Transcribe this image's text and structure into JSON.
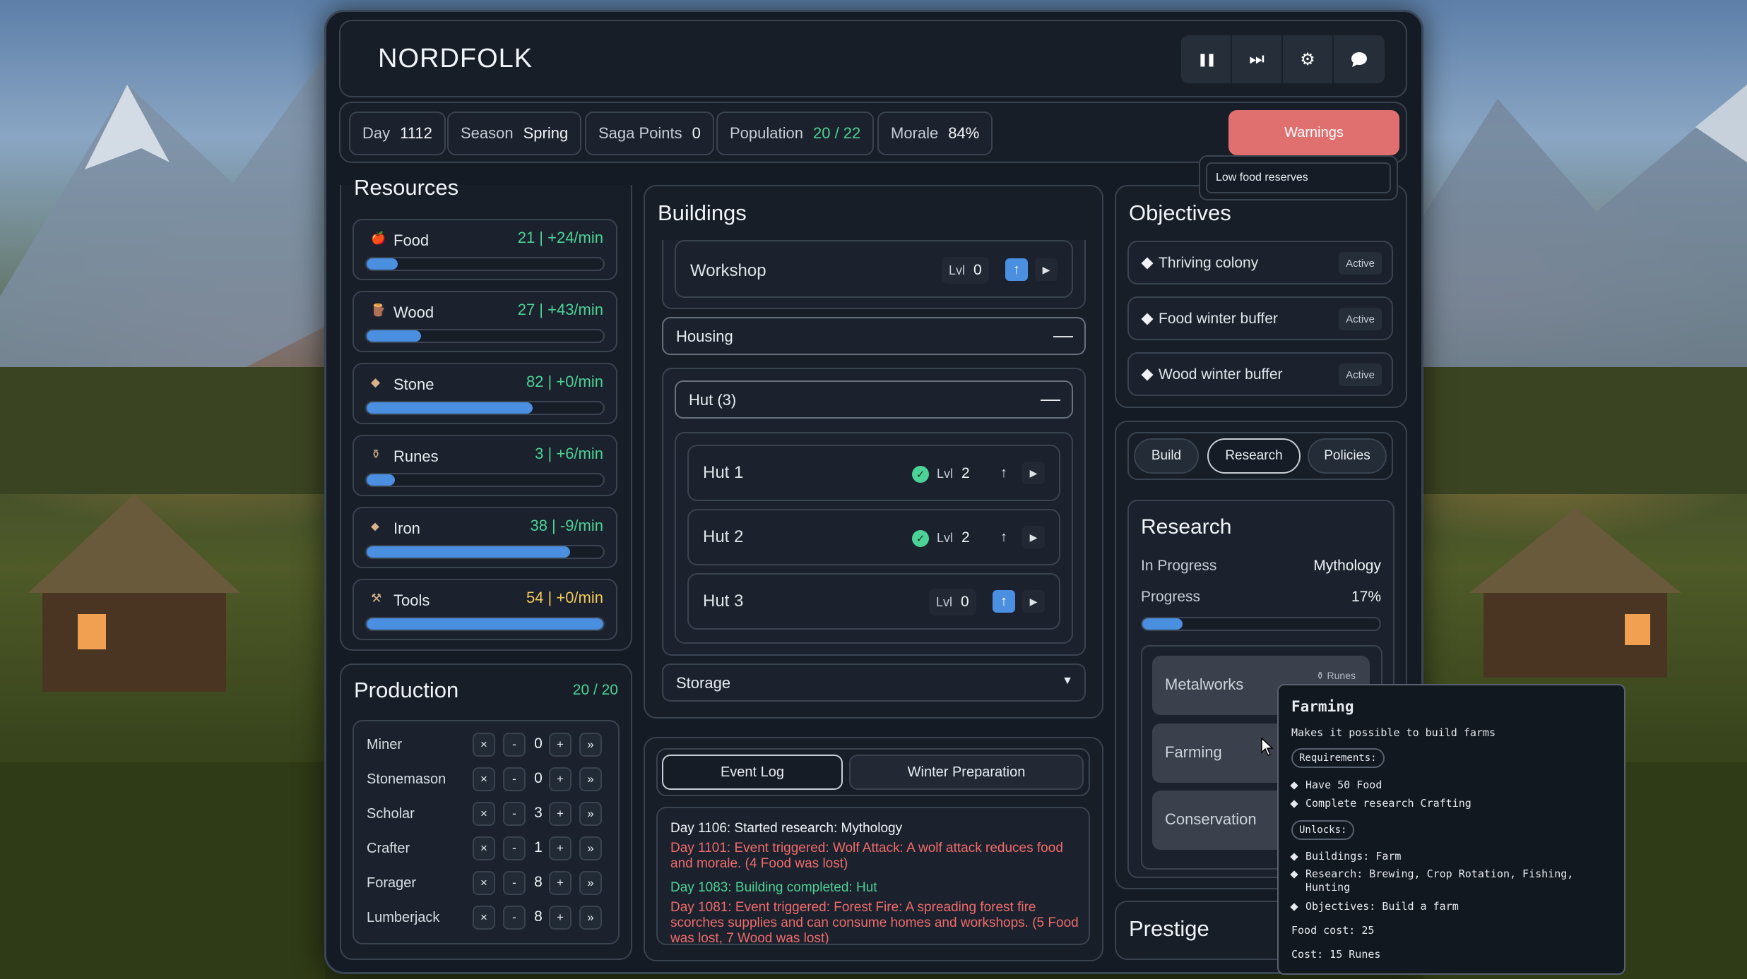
{
  "app_title": "NORDFOLK",
  "controls": [
    {
      "name": "pause-icon",
      "glyph": "❚❚"
    },
    {
      "name": "skip-forward-icon",
      "glyph": "⏭"
    },
    {
      "name": "gear-icon",
      "glyph": "⚙"
    },
    {
      "name": "chat-bubble-icon",
      "glyph": "💬"
    }
  ],
  "stats": {
    "day": {
      "label": "Day",
      "value": "1112"
    },
    "season": {
      "label": "Season",
      "value": "Spring"
    },
    "saga": {
      "label": "Saga Points",
      "value": "0"
    },
    "population": {
      "label": "Population",
      "value": "20 / 22"
    },
    "morale": {
      "label": "Morale",
      "value": "84%"
    }
  },
  "warnings": {
    "label": "Warnings",
    "items": [
      "Low food reserves"
    ]
  },
  "resources": {
    "title": "Resources",
    "items": [
      {
        "name": "Food",
        "icon": "apple-icon",
        "value": "21 | +24/min",
        "fill": 0.13,
        "value_color": "green"
      },
      {
        "name": "Wood",
        "icon": "log-icon",
        "value": "27 | +43/min",
        "fill": 0.23,
        "value_color": "green"
      },
      {
        "name": "Stone",
        "icon": "stone-icon",
        "value": "82 | +0/min",
        "fill": 0.7,
        "value_color": "green"
      },
      {
        "name": "Runes",
        "icon": "rune-icon",
        "value": "3 | +6/min",
        "fill": 0.12,
        "value_color": "green"
      },
      {
        "name": "Iron",
        "icon": "iron-icon",
        "value": "38 | -9/min",
        "fill": 0.86,
        "value_color": "green"
      },
      {
        "name": "Tools",
        "icon": "tools-icon",
        "value": "54 | +0/min",
        "fill": 1.0,
        "value_color": "yellow"
      }
    ]
  },
  "production": {
    "title": "Production",
    "count": "20 / 20",
    "rows": [
      {
        "name": "Miner",
        "value": "0"
      },
      {
        "name": "Stonemason",
        "value": "0"
      },
      {
        "name": "Scholar",
        "value": "3"
      },
      {
        "name": "Crafter",
        "value": "1"
      },
      {
        "name": "Forager",
        "value": "8"
      },
      {
        "name": "Lumberjack",
        "value": "8"
      }
    ],
    "btn_clear": "×",
    "btn_minus": "-",
    "btn_plus": "+",
    "btn_max": "»"
  },
  "buildings": {
    "title": "Buildings",
    "workshop": {
      "name": "Workshop",
      "lvl_label": "Lvl",
      "lvl": "0"
    },
    "housing_label": "Housing",
    "hut_group_label": "Hut (3)",
    "huts": [
      {
        "name": "Hut 1",
        "lvl": "2",
        "built": true
      },
      {
        "name": "Hut 2",
        "lvl": "2",
        "built": true
      },
      {
        "name": "Hut 3",
        "lvl": "0",
        "built": false
      }
    ],
    "lvl_label": "Lvl",
    "storage_label": "Storage"
  },
  "log": {
    "tabs": [
      "Event Log",
      "Winter Preparation"
    ],
    "entries": [
      {
        "text": "Day 1106: Started research: Mythology",
        "color": "#f1f4f8"
      },
      {
        "text": "Day 1101: Event triggered: Wolf Attack: A wolf attack reduces food and morale. (4 Food was lost)",
        "color": "#ef6b6b"
      },
      {
        "text": "Day 1083: Building completed: Hut",
        "color": "#4cd296"
      },
      {
        "text": "Day 1081: Event triggered: Forest Fire: A spreading forest fire scorches supplies and can consume homes and workshops. (5 Food was lost, 7 Wood was lost)",
        "color": "#ef6b6b"
      }
    ]
  },
  "objectives": {
    "title": "Objectives",
    "items": [
      {
        "name": "Thriving colony",
        "status": "Active"
      },
      {
        "name": "Food winter buffer",
        "status": "Active"
      },
      {
        "name": "Wood winter buffer",
        "status": "Active"
      }
    ]
  },
  "right_tabs": [
    "Build",
    "Research",
    "Policies"
  ],
  "research": {
    "title": "Research",
    "in_progress_label": "In Progress",
    "in_progress_value": "Mythology",
    "progress_label": "Progress",
    "progress_value": "17%",
    "progress_fraction": 0.17,
    "items": [
      {
        "name": "Metalworks",
        "cost": "Runes"
      },
      {
        "name": "Farming"
      },
      {
        "name": "Conservation"
      }
    ]
  },
  "prestige_title": "Prestige",
  "tooltip": {
    "title": "Farming",
    "desc": "Makes it possible to build farms",
    "req_label": "Requirements:",
    "requirements": [
      "Have 50 Food",
      "Complete research Crafting"
    ],
    "unlocks_label": "Unlocks:",
    "unlocks": [
      "Buildings: Farm",
      "Research: Brewing, Crop Rotation, Fishing, Hunting",
      "Objectives: Build a farm"
    ],
    "food_cost": "Food cost: 25",
    "cost": "Cost: 15 Runes"
  },
  "colors": {
    "accent_blue": "#4b8fe0",
    "positive_green": "#4cd296",
    "warning_red": "#e06f6f",
    "negative_red": "#ef6b6b",
    "tools_yellow": "#f4c95a"
  }
}
